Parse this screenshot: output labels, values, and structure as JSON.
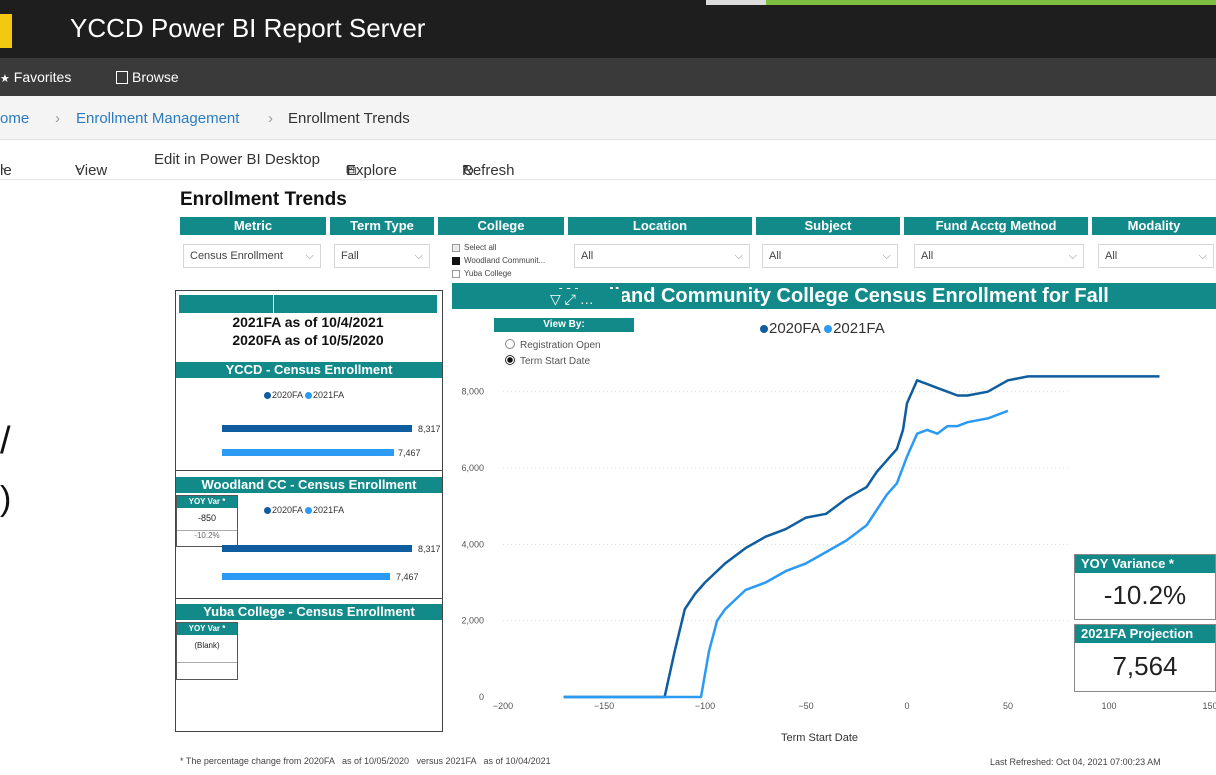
{
  "app": {
    "title": "YCCD Power BI Report Server"
  },
  "nav": {
    "favorites": "Favorites",
    "browse": "Browse"
  },
  "breadcrumb": {
    "home": "ome",
    "folder": "Enrollment Management",
    "current": "Enrollment Trends"
  },
  "toolbar": {
    "file": "le",
    "view": "View",
    "edit": "Edit in Power BI Desktop",
    "explore": "Explore",
    "refresh": "Refresh"
  },
  "report": {
    "title": "Enrollment Trends",
    "filters": {
      "headers": [
        "Metric",
        "Term Type",
        "College",
        "Location",
        "Subject",
        "Fund Acctg Method",
        "Modality"
      ],
      "metric": "Census Enrollment",
      "term_type": "Fall",
      "location": "All",
      "subject": "All",
      "fund": "All",
      "modality": "All",
      "college_options": [
        "Select all",
        "Woodland Communit...",
        "Yuba College"
      ]
    },
    "asof": {
      "line1": "2021FA  as of 10/4/2021",
      "line2": "2020FA  as of 10/5/2020"
    },
    "ycdd": {
      "header": "YCCD - Census Enrollment",
      "val2020": "8,317",
      "val2021": "7,467"
    },
    "woodland": {
      "header": "Woodland CC - Census Enrollment",
      "yoy_header": "YOY Var *",
      "yoy_value": "-850",
      "yoy_pct": "-10.2%",
      "val2020": "8,317",
      "val2021": "7,467"
    },
    "yuba": {
      "header": "Yuba College - Census Enrollment",
      "yoy_header": "YOY Var *",
      "yoy_value": "(Blank)"
    },
    "legend": {
      "s2020": "2020FA",
      "s2021": "2021FA"
    },
    "viewby": {
      "header": "View By:",
      "opt1": "Registration Open",
      "opt2": "Term Start Date"
    },
    "chart_header": "Woodland Community College Census Enrollment for Fall",
    "yoy_card": {
      "title": "YOY Variance *",
      "value": "-10.2%"
    },
    "proj_card": {
      "title": "2021FA Projection",
      "value": "7,564"
    },
    "footnote": "* The percentage change from 2020FA   as of 10/05/2020   versus 2021FA   as of 10/04/2021",
    "last_refreshed": "Last Refreshed: Oct 04, 2021 07:00:23 AM"
  },
  "colors": {
    "teal": "#138a8a",
    "s2020": "#0f5c9e",
    "s2021": "#2b9af3"
  },
  "chart_data": {
    "type": "line",
    "xlabel": "Term Start Date",
    "ylabel": "",
    "xlim": [
      -200,
      150
    ],
    "ylim": [
      0,
      8700
    ],
    "x_ticks": [
      -200,
      -150,
      -100,
      -50,
      0,
      50,
      100,
      150
    ],
    "y_ticks": [
      0,
      2000,
      4000,
      6000,
      8000
    ],
    "y_tick_labels": [
      "0",
      "2,000",
      "4,000",
      "6,000",
      "8,000"
    ],
    "series": [
      {
        "name": "2020FA",
        "color": "#0f5c9e",
        "x": [
          -170,
          -120,
          -115,
          -110,
          -105,
          -100,
          -90,
          -80,
          -70,
          -60,
          -50,
          -40,
          -30,
          -20,
          -15,
          -10,
          -5,
          -2,
          0,
          5,
          10,
          15,
          20,
          25,
          30,
          40,
          50,
          60,
          80,
          100,
          125
        ],
        "y": [
          0,
          0,
          1200,
          2300,
          2700,
          3000,
          3500,
          3900,
          4200,
          4400,
          4700,
          4800,
          5200,
          5500,
          5900,
          6200,
          6500,
          7000,
          7700,
          8300,
          8200,
          8100,
          8000,
          7900,
          7900,
          8000,
          8300,
          8400,
          8400,
          8400,
          8400
        ]
      },
      {
        "name": "2021FA",
        "color": "#2b9af3",
        "x": [
          -170,
          -102,
          -98,
          -94,
          -90,
          -80,
          -70,
          -60,
          -50,
          -40,
          -30,
          -20,
          -15,
          -10,
          -5,
          0,
          5,
          10,
          15,
          20,
          25,
          30,
          40,
          50
        ],
        "y": [
          0,
          0,
          1200,
          2000,
          2300,
          2800,
          3000,
          3300,
          3500,
          3800,
          4100,
          4500,
          4900,
          5300,
          5600,
          6300,
          6900,
          7000,
          6900,
          7100,
          7100,
          7200,
          7300,
          7500
        ]
      }
    ]
  }
}
